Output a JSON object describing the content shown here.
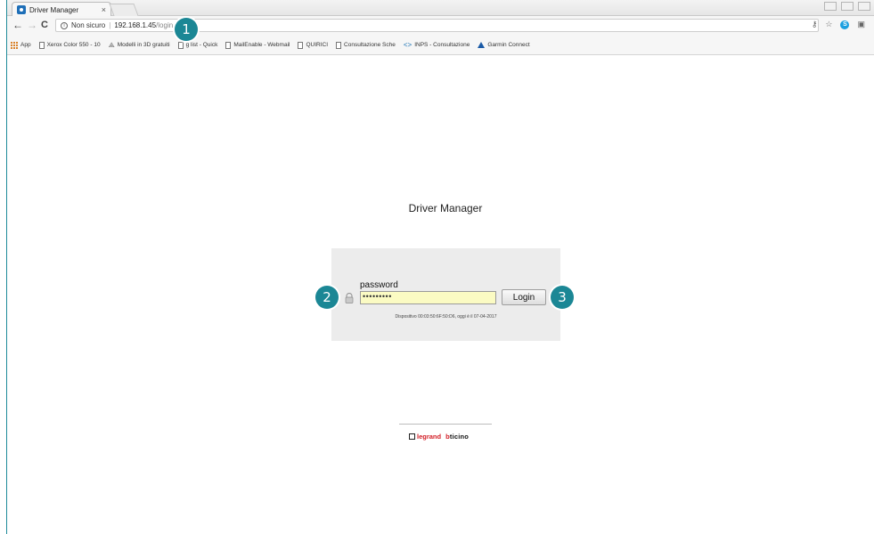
{
  "browser": {
    "tab_title": "Driver Manager",
    "tab_close": "×",
    "nav_back": "←",
    "nav_forward": "→",
    "nav_reload": "C",
    "security_label": "Non sicuro",
    "url_host": "192.168.1.45",
    "url_path": "/login.php",
    "omni_separator": "|"
  },
  "bookmarks": {
    "items": [
      {
        "label": "App",
        "icon": "apps-grid-icon"
      },
      {
        "label": "Xerox Color 550 - 10",
        "icon": "page-icon"
      },
      {
        "label": "Modelli in 3D gratuiti",
        "icon": "model-icon"
      },
      {
        "label": "g list - Quick ",
        "icon": "page-icon"
      },
      {
        "label": "MailEnable - Webmail",
        "icon": "page-icon"
      },
      {
        "label": "QUIRICI",
        "icon": "page-icon"
      },
      {
        "label": "Consultazione Sche",
        "icon": "page-icon"
      },
      {
        "label": "INPS - Consultazione",
        "icon": "chevron-icon"
      },
      {
        "label": "Garmin Connect",
        "icon": "garmin-icon"
      }
    ]
  },
  "page": {
    "title": "Driver Manager",
    "password_label": "password",
    "password_value": "•••••••••",
    "login_button": "Login",
    "device_info": "Dispositivo 00:03:50:6F:50:D6, oggi è il 07-04-2017",
    "brand_legrand": "legrand",
    "brand_bticino_b": "b",
    "brand_bticino_rest": "ticino"
  },
  "callouts": {
    "one": "1",
    "two": "2",
    "three": "3"
  },
  "colors": {
    "callout": "#1b8795",
    "input_autofill": "#fbfbc3",
    "legrand_red": "#d21d25"
  }
}
